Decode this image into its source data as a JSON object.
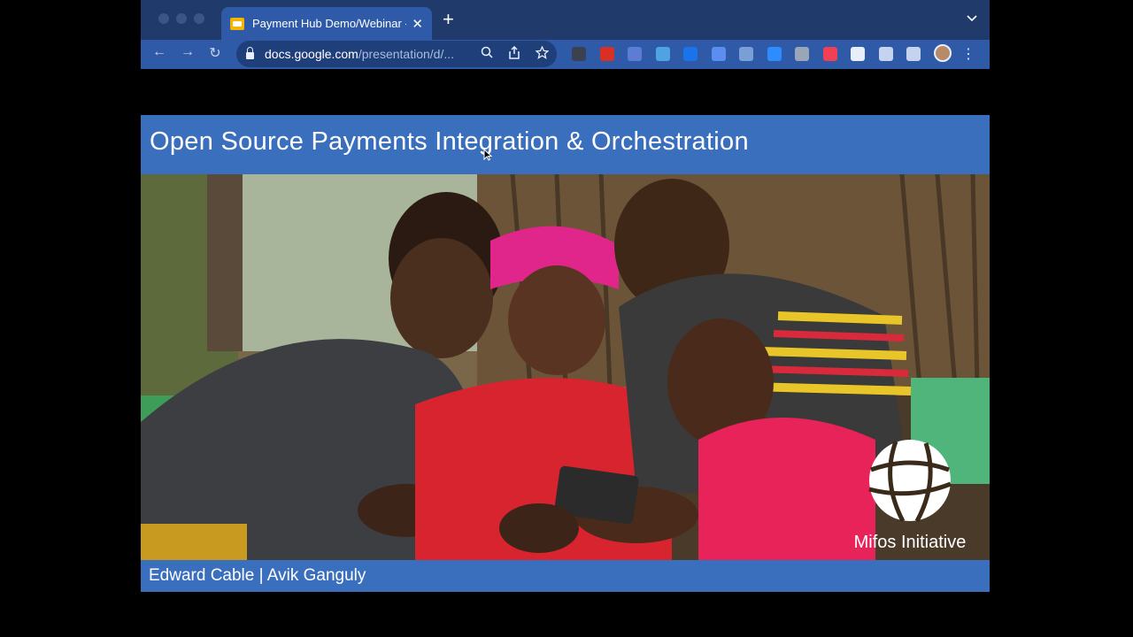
{
  "browser": {
    "tab": {
      "title": "Payment Hub Demo/Webinar -",
      "close": "✕"
    },
    "new_tab": "+",
    "tab_search": "⌄",
    "nav": {
      "back": "←",
      "forward": "→",
      "reload": "↻"
    },
    "url": {
      "host": "docs.google.com",
      "path": "/presentation/d/..."
    },
    "menu": "⋮",
    "extensions": [
      {
        "name": "f10-extension-icon",
        "color": "#3a4252"
      },
      {
        "name": "gmail-icon",
        "color": "#d93025"
      },
      {
        "name": "calendar-extension-icon",
        "color": "#5c7cd6"
      },
      {
        "name": "cloud-extension-icon",
        "color": "#4fa3e0"
      },
      {
        "name": "sync-extension-icon",
        "color": "#1a73e8"
      },
      {
        "name": "bookmark-extension-icon",
        "color": "#5b8ef0"
      },
      {
        "name": "link-extension-icon",
        "color": "#7a9ed6"
      },
      {
        "name": "zoom-extension-icon",
        "color": "#2d8cff"
      },
      {
        "name": "cup-extension-icon",
        "color": "#9aa6b8"
      },
      {
        "name": "pocket-icon",
        "color": "#ef4056"
      },
      {
        "name": "record-extension-icon",
        "color": "#e8eefa"
      },
      {
        "name": "puzzle-extensions-icon",
        "color": "#c5d3ee"
      },
      {
        "name": "sidebar-icon",
        "color": "#c5d3ee"
      }
    ]
  },
  "slide": {
    "title": "Open Source Payments Integration & Orchestration",
    "speakers": "Edward Cable   | Avik Ganguly",
    "logo_text": "Mifos Initiative"
  }
}
